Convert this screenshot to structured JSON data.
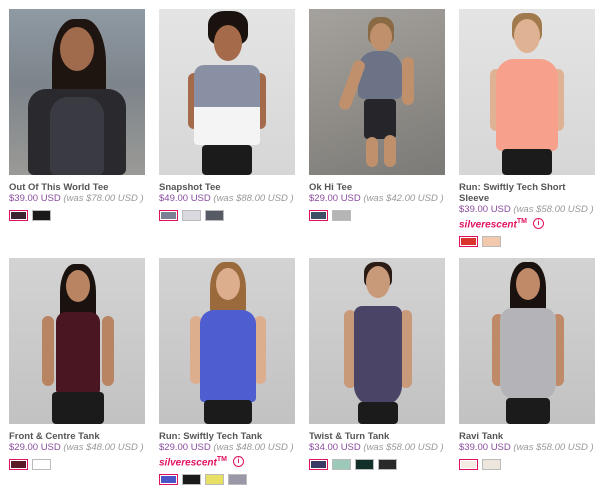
{
  "products": [
    {
      "name": "Out Of This World Tee",
      "price": "$39.00 USD",
      "was": "(was $78.00 USD )",
      "swatches": [
        "#3a2530",
        "#1a1a1a"
      ],
      "selected": 0,
      "badge": ""
    },
    {
      "name": "Snapshot Tee",
      "price": "$49.00 USD",
      "was": "(was $88.00 USD )",
      "swatches": [
        "#7b7f93",
        "#d9d9df",
        "#555a64"
      ],
      "selected": 0,
      "badge": ""
    },
    {
      "name": "Ok Hi Tee",
      "price": "$29.00 USD",
      "was": "(was $42.00 USD )",
      "swatches": [
        "#3e4f66",
        "#b5b5b5"
      ],
      "selected": 0,
      "badge": ""
    },
    {
      "name": "Run: Swiftly Tech Short Sleeve",
      "price": "$39.00 USD",
      "was": "(was $58.00 USD )",
      "swatches": [
        "#d9352c",
        "#f2c9ad"
      ],
      "selected": 0,
      "badge": "silverescent",
      "badge_tm": "TM"
    },
    {
      "name": "Front & Centre Tank",
      "price": "$29.00 USD",
      "was": "(was $48.00 USD )",
      "swatches": [
        "#5a1a28",
        "#ffffff"
      ],
      "selected": 0,
      "badge": ""
    },
    {
      "name": "Run: Swiftly Tech Tank",
      "price": "$29.00 USD",
      "was": "(was $48.00 USD )",
      "swatches": [
        "#4b55c8",
        "#1a1a1a",
        "#e8e065",
        "#9a98a8"
      ],
      "selected": 0,
      "badge": "silverescent",
      "badge_tm": "TM"
    },
    {
      "name": "Twist & Turn Tank",
      "price": "$34.00 USD",
      "was": "(was $58.00 USD )",
      "swatches": [
        "#3b3a66",
        "#9cc9b8",
        "#12302a",
        "#2a2a2a"
      ],
      "selected": 0,
      "badge": ""
    },
    {
      "name": "Ravi Tank",
      "price": "$39.00 USD",
      "was": "(was $58.00 USD )",
      "swatches": [
        "#f4ece2",
        "#ece6dd"
      ],
      "selected": 0,
      "badge": ""
    }
  ],
  "colors": {
    "price": "#8a4c9e",
    "badge": "#e0115f"
  },
  "icons": {
    "badge_info": "info-icon"
  },
  "info_glyph": "i"
}
